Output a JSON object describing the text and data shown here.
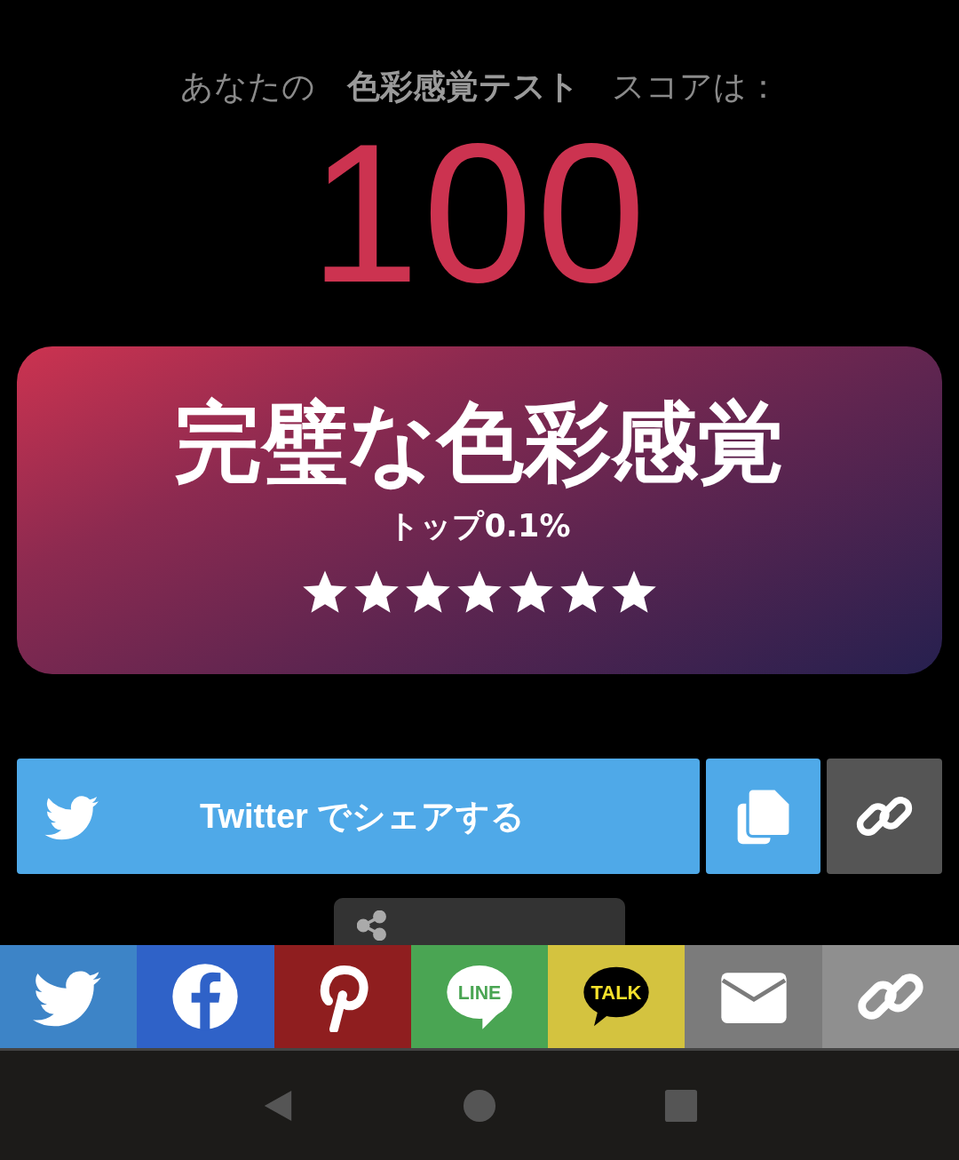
{
  "heading": {
    "prefix": "あなたの",
    "test_name": "色彩感覚テスト",
    "suffix": "スコアは："
  },
  "score": "100",
  "result": {
    "title": "完璧な色彩感覚",
    "rank": "トップ0.1%",
    "stars": 7
  },
  "share_buttons": [
    {
      "kind": "twitter",
      "label": "Twitter でシェアする"
    },
    {
      "kind": "copy"
    },
    {
      "kind": "link"
    }
  ],
  "share_bar": [
    {
      "kind": "twitter"
    },
    {
      "kind": "facebook"
    },
    {
      "kind": "pinterest"
    },
    {
      "kind": "line",
      "label": "LINE"
    },
    {
      "kind": "kakaotalk",
      "label": "TALK"
    },
    {
      "kind": "email"
    },
    {
      "kind": "link"
    }
  ],
  "nav_bar": [
    {
      "kind": "back"
    },
    {
      "kind": "home"
    },
    {
      "kind": "recents"
    }
  ]
}
